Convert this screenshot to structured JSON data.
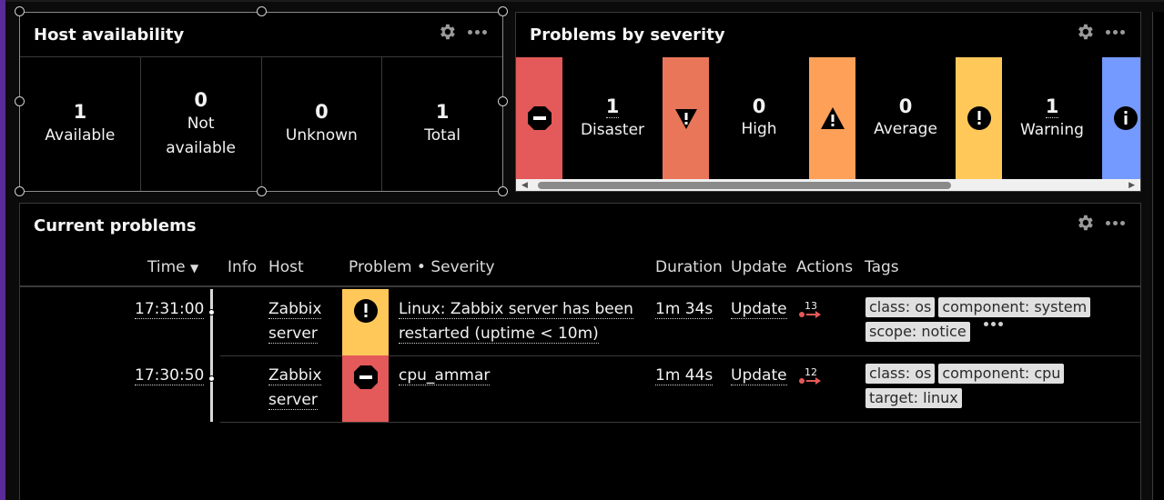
{
  "colors": {
    "disaster": "#e45959",
    "high": "#e97659",
    "average": "#ffa059",
    "warning": "#ffc859",
    "information": "#7499ff"
  },
  "host_availability": {
    "title": "Host availability",
    "cells": [
      {
        "count": "1",
        "label": "Available"
      },
      {
        "count": "0",
        "label": "Not available"
      },
      {
        "count": "0",
        "label": "Unknown"
      },
      {
        "count": "1",
        "label": "Total"
      }
    ]
  },
  "problems_by_severity": {
    "title": "Problems by severity",
    "items": [
      {
        "count": "1",
        "label": "Disaster",
        "icon": "disaster-icon"
      },
      {
        "count": "0",
        "label": "High",
        "icon": "high-icon"
      },
      {
        "count": "0",
        "label": "Average",
        "icon": "average-icon"
      },
      {
        "count": "1",
        "label": "Warning",
        "icon": "warning-icon"
      }
    ],
    "trailing_icon": "information-icon"
  },
  "current_problems": {
    "title": "Current problems",
    "headers": {
      "time": "Time",
      "info": "Info",
      "host": "Host",
      "problem": "Problem • Severity",
      "duration": "Duration",
      "update": "Update",
      "actions": "Actions",
      "tags": "Tags"
    },
    "rows": [
      {
        "time": "17:31:00",
        "host_line1": "Zabbix",
        "host_line2": "server",
        "problem_line1": "Linux: Zabbix server has been",
        "problem_line2": "restarted (uptime < 10m)",
        "severity": "warning",
        "duration": "1m 34s",
        "update": "Update",
        "actions_count": "13",
        "tags": [
          "class: os",
          "component: system",
          "scope: notice"
        ]
      },
      {
        "time": "17:30:50",
        "host_line1": "Zabbix",
        "host_line2": "server",
        "problem_line1": "cpu_ammar",
        "problem_line2": "",
        "severity": "disaster",
        "duration": "1m 44s",
        "update": "Update",
        "actions_count": "12",
        "tags": [
          "class: os",
          "component: cpu",
          "target: linux"
        ]
      }
    ]
  }
}
